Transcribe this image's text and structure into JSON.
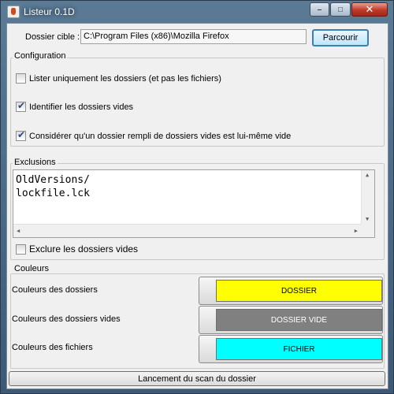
{
  "window": {
    "title": "Listeur 0.1D",
    "minimize": "–",
    "maximize": "□",
    "close": "✕"
  },
  "target": {
    "label": "Dossier cible :",
    "value": "C:\\Program Files (x86)\\Mozilla Firefox",
    "browse_label": "Parcourir"
  },
  "configuration": {
    "title": "Configuration",
    "options": [
      {
        "label": "Lister uniquement les dossiers (et pas les fichiers)",
        "checked": false
      },
      {
        "label": "Identifier les dossiers vides",
        "checked": true
      },
      {
        "label": "Considérer qu'un dossier rempli de dossiers vides est lui-même vide",
        "checked": true
      }
    ]
  },
  "exclusions": {
    "title": "Exclusions",
    "lines": [
      "OldVersions/",
      "lockfile.lck"
    ],
    "exclude_empty_label": "Exclure les dossiers vides",
    "exclude_empty_checked": false
  },
  "colors": {
    "title": "Couleurs",
    "rows": [
      {
        "label": "Couleurs des dossiers",
        "swatch_text": "DOSSIER",
        "swatch_color": "#ffff00",
        "text_color": "#000000"
      },
      {
        "label": "Couleurs des dossiers vides",
        "swatch_text": "DOSSIER VIDE",
        "swatch_color": "#808080",
        "text_color": "#ffffff"
      },
      {
        "label": "Couleurs des fichiers",
        "swatch_text": "FICHIER",
        "swatch_color": "#00ffff",
        "text_color": "#000000"
      }
    ]
  },
  "scan_button_label": "Lancement du scan du dossier"
}
